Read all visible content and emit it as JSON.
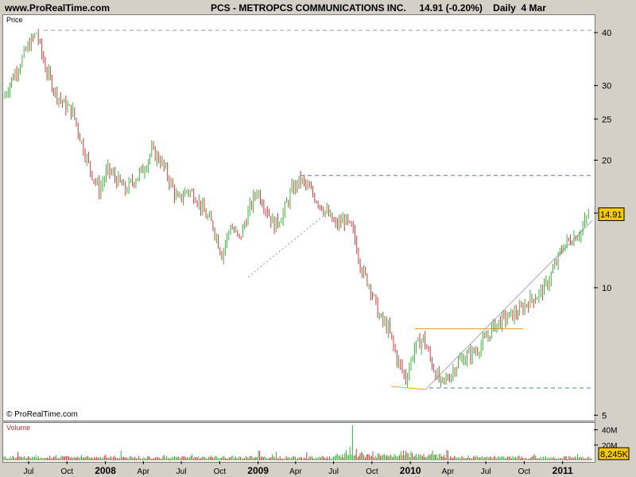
{
  "header": {
    "site": "www.ProRealTime.com",
    "title": "PCS - METROPCS COMMUNICATIONS INC.     14.91 (-0.20%)    Daily  4 Mar"
  },
  "price_panel": {
    "label": "Price",
    "credit": "© ProRealTime.com"
  },
  "volume_panel": {
    "label": "Volume"
  },
  "colors": {
    "up": "#3cb43c",
    "down": "#c83c3c",
    "trend_orange": "#f0a020",
    "trend_blue_dash": "#5a78c8",
    "gray_dash": "#9a9a9a",
    "tag_background": "#f5c800"
  },
  "chart_data": [
    {
      "type": "candlestick",
      "title": "PCS - METROPCS COMMUNICATIONS INC.",
      "ylabel": "Price",
      "yscale": "log",
      "ylim": [
        4.9,
        44
      ],
      "y_ticks": [
        5,
        10,
        15,
        20,
        25,
        30,
        40
      ],
      "y_tick_labels": [
        "5",
        "10",
        "15",
        "20",
        "25",
        "30",
        "40"
      ],
      "last_price": 14.91,
      "last_price_label": "14.91",
      "x": [
        "2007-05-01",
        "2007-05-21",
        "2007-06-11",
        "2007-06-29",
        "2007-07-20",
        "2007-08-10",
        "2007-09-03",
        "2007-09-24",
        "2007-10-15",
        "2007-11-05",
        "2007-11-26",
        "2007-12-17",
        "2008-01-07",
        "2008-01-28",
        "2008-02-18",
        "2008-03-10",
        "2008-03-31",
        "2008-04-21",
        "2008-05-12",
        "2008-06-02",
        "2008-06-23",
        "2008-07-14",
        "2008-08-04",
        "2008-08-25",
        "2008-09-15",
        "2008-10-06",
        "2008-10-27",
        "2008-11-17",
        "2008-12-08",
        "2008-12-29",
        "2009-01-19",
        "2009-02-09",
        "2009-03-02",
        "2009-03-23",
        "2009-04-13",
        "2009-05-04",
        "2009-05-25",
        "2009-06-15",
        "2009-07-06",
        "2009-07-27",
        "2009-08-17",
        "2009-09-07",
        "2009-09-28",
        "2009-10-19",
        "2009-11-09",
        "2009-11-30",
        "2009-12-21",
        "2010-01-11",
        "2010-02-01",
        "2010-02-22",
        "2010-03-15",
        "2010-04-05",
        "2010-04-26",
        "2010-05-17",
        "2010-06-07",
        "2010-06-28",
        "2010-07-19",
        "2010-08-09",
        "2010-08-30",
        "2010-09-20",
        "2010-10-11",
        "2010-11-01",
        "2010-11-22",
        "2010-12-13",
        "2011-01-03",
        "2011-01-24",
        "2011-02-14",
        "2011-03-04"
      ],
      "close": [
        28,
        31,
        34,
        37,
        40,
        33,
        29,
        27,
        26,
        22,
        19,
        17,
        19,
        18,
        17,
        18,
        19,
        21,
        20,
        18,
        16,
        17,
        16.5,
        15,
        14,
        12,
        14,
        13,
        15,
        17,
        15.5,
        14,
        15,
        17,
        18,
        17,
        16,
        15,
        14,
        14.5,
        13.5,
        11,
        10,
        8.5,
        8,
        6.8,
        6.1,
        7.2,
        7.6,
        6.6,
        5.9,
        6.2,
        6.7,
        6.9,
        7.1,
        7.5,
        8.1,
        8.4,
        8.6,
        8.8,
        9.3,
        9.6,
        10.1,
        11.2,
        12.6,
        13.1,
        13.6,
        14.91
      ],
      "annotations": [
        {
          "kind": "hline-dashed",
          "y": 40.5
        },
        {
          "kind": "hline-dashed",
          "y": 18.4
        },
        {
          "kind": "hline-dashed",
          "y": 5.8
        },
        {
          "kind": "hline-solid",
          "y": 8.0
        }
      ]
    },
    {
      "type": "bar",
      "title": "Volume",
      "y_tick_labels": [
        "40M",
        "20M"
      ],
      "last_volume_label": "8,245K"
    }
  ],
  "x_axis_labels": [
    "Jul",
    "Oct",
    "2008",
    "Apr",
    "Jul",
    "Oct",
    "2009",
    "Apr",
    "Jul",
    "Oct",
    "2010",
    "Apr",
    "Jul",
    "Oct",
    "2011"
  ],
  "x_axis_bold": [
    false,
    false,
    true,
    false,
    false,
    false,
    true,
    false,
    false,
    false,
    true,
    false,
    false,
    false,
    true
  ]
}
